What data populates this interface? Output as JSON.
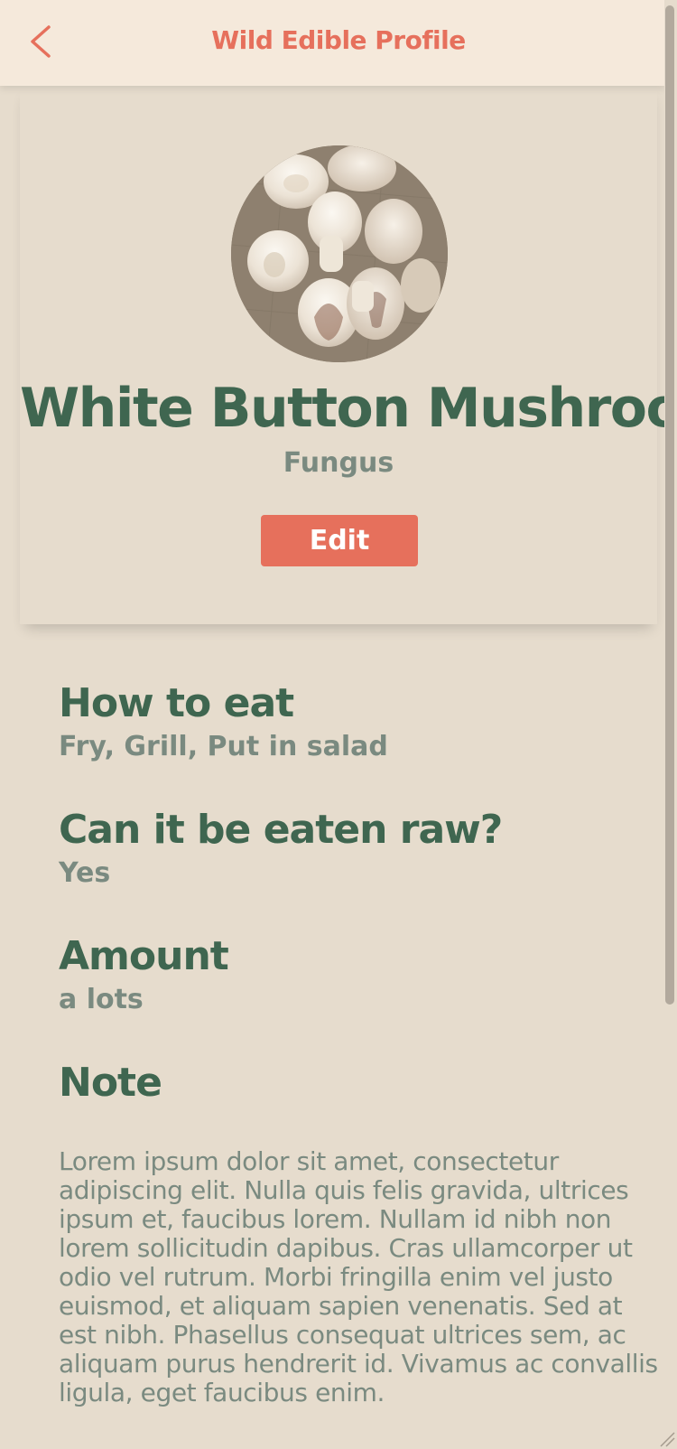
{
  "header": {
    "title": "Wild Edible Profile",
    "back_icon": "chevron-left-icon"
  },
  "profile": {
    "name": "White Button Mushroom",
    "type": "Fungus",
    "edit_label": "Edit",
    "photo": "mushroom-photo"
  },
  "details": {
    "how_to_eat": {
      "heading": "How to eat",
      "value": "Fry, Grill, Put in salad"
    },
    "raw": {
      "heading": "Can it be eaten raw?",
      "value": "Yes"
    },
    "amount": {
      "heading": "Amount",
      "value": "a lots"
    },
    "note": {
      "heading": "Note",
      "value": "Lorem ipsum dolor sit amet, consectetur adipiscing elit. Nulla quis felis gravida, ultrices ipsum et, faucibus lorem. Nullam id nibh non lorem sollicitudin dapibus. Cras ullamcorper ut odio vel rutrum. Morbi fringilla enim vel justo euismod, et aliquam sapien venenatis. Sed at est nibh. Phasellus consequat ultrices sem, ac aliquam purus hendrerit id. Vivamus ac convallis ligula, eget faucibus enim."
    }
  },
  "colors": {
    "accent": "#e6705c",
    "heading": "#3f6650",
    "muted": "#7a8a80",
    "background": "#e6dccd",
    "header_bg": "#f5e9db"
  }
}
